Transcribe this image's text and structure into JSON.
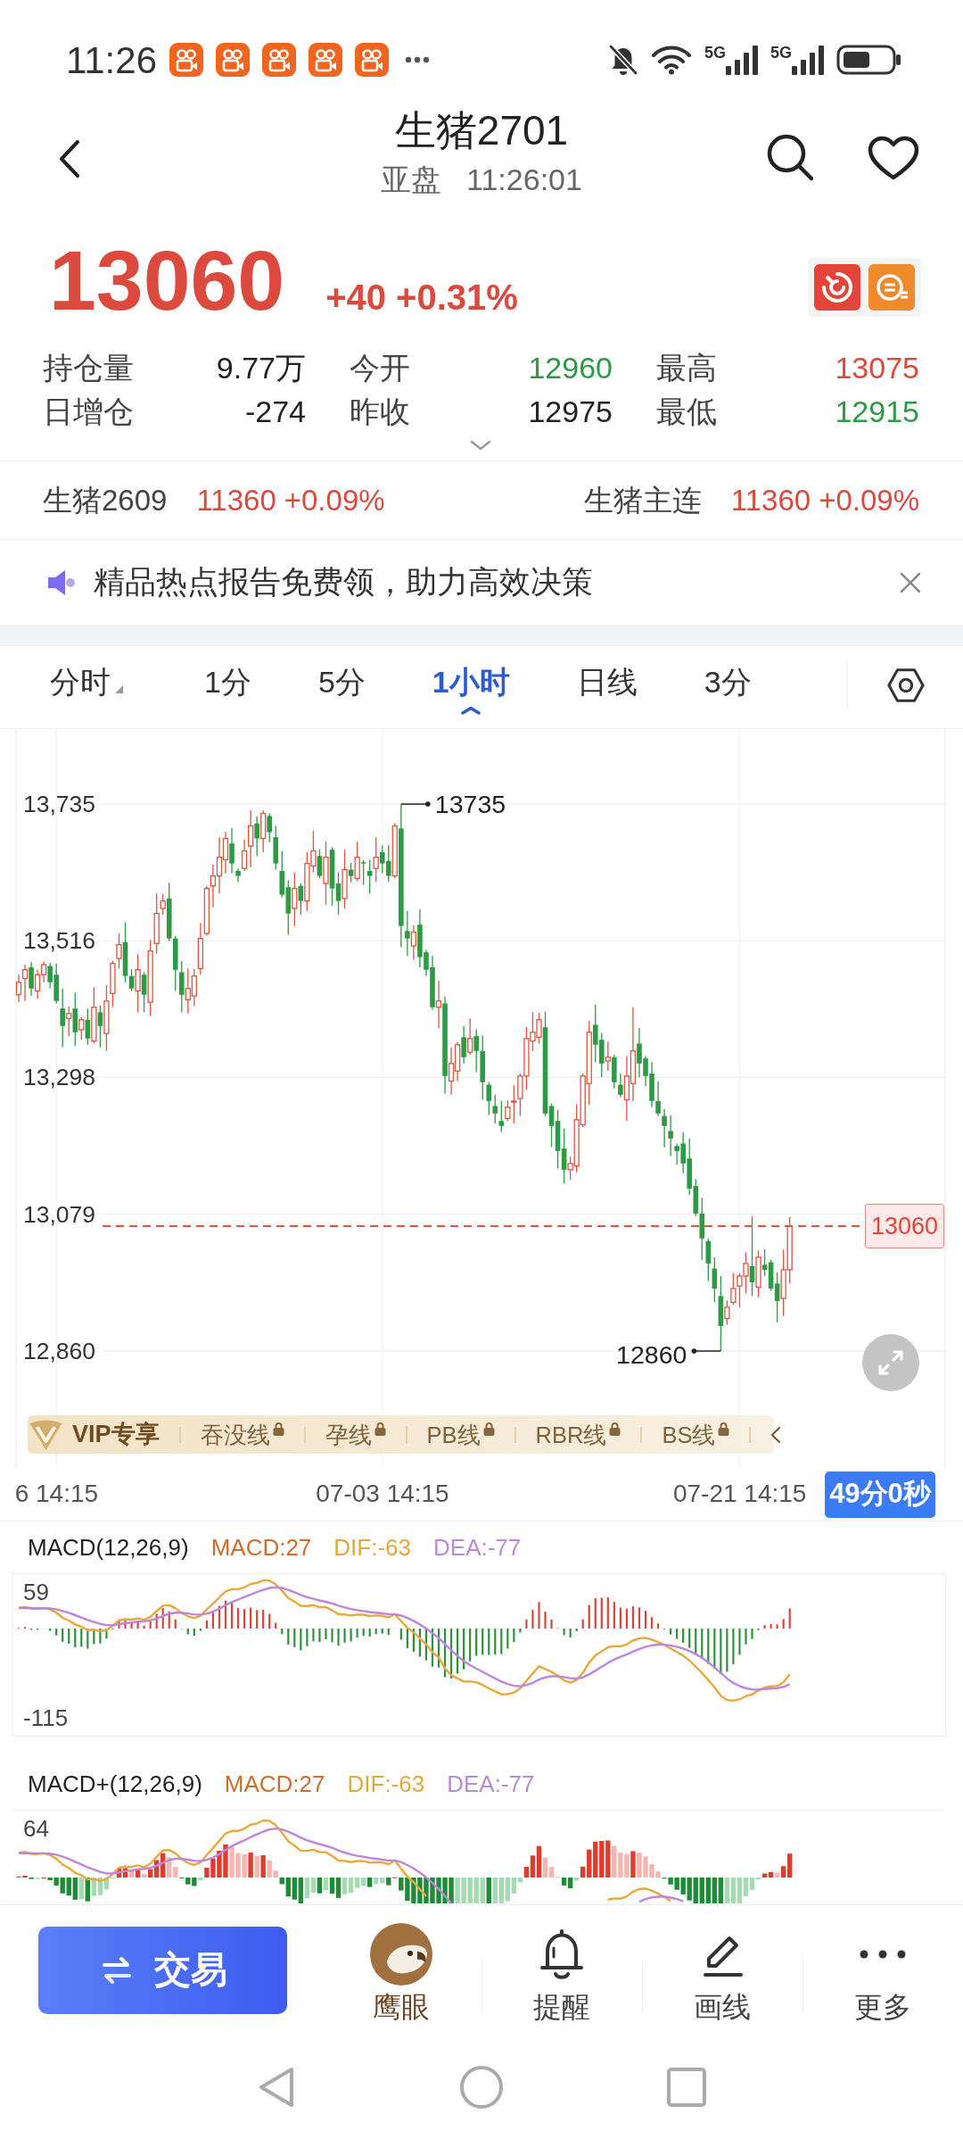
{
  "status_bar": {
    "time": "11:26",
    "network_labels": [
      "5G",
      "5G"
    ]
  },
  "header": {
    "title": "生猪2701",
    "session": "亚盘",
    "time": "11:26:01"
  },
  "quote": {
    "price": "13060",
    "change": "+40",
    "change_percent": "+0.31%",
    "rising": true
  },
  "stats": [
    {
      "label": "持仓量",
      "value": "9.77万",
      "color": "#222222"
    },
    {
      "label": "今开",
      "value": "12960",
      "color": "#2e9a48"
    },
    {
      "label": "最高",
      "value": "13075",
      "color": "#dc4a3e"
    },
    {
      "label": "日增仓",
      "value": "-274",
      "color": "#222222"
    },
    {
      "label": "昨收",
      "value": "12975",
      "color": "#222222"
    },
    {
      "label": "最低",
      "value": "12915",
      "color": "#2e9a48"
    }
  ],
  "related": [
    {
      "name": "生猪2609",
      "price": "11360",
      "change": "+0.09%",
      "color": "#dc4a3e"
    },
    {
      "name": "生猪主连",
      "price": "11360",
      "change": "+0.09%",
      "color": "#dc4a3e"
    }
  ],
  "banner": {
    "text": "精品热点报告免费领，助力高效决策"
  },
  "periods": [
    {
      "label": "分时",
      "selected": false,
      "dropdown": true
    },
    {
      "label": "1分",
      "selected": false,
      "dropdown": false
    },
    {
      "label": "5分",
      "selected": false,
      "dropdown": false
    },
    {
      "label": "1小时",
      "selected": true,
      "dropdown": false
    },
    {
      "label": "日线",
      "selected": false,
      "dropdown": false
    },
    {
      "label": "3分",
      "selected": false,
      "dropdown": false
    }
  ],
  "chart": {
    "chart_data": {
      "type": "candlestick",
      "categories": [
        null,
        null,
        null,
        null,
        null,
        null,
        "6 14:15",
        null,
        null,
        null,
        null,
        null,
        null,
        null,
        null,
        null,
        null,
        null,
        null,
        null,
        null,
        null,
        null,
        null,
        null,
        null,
        null,
        null,
        null,
        null,
        null,
        null,
        null,
        null,
        null,
        null,
        null,
        null,
        null,
        null,
        null,
        null,
        null,
        null,
        null,
        null,
        null,
        null,
        null,
        null,
        null,
        null,
        null,
        null,
        null,
        null,
        null,
        null,
        "07-03 14:15",
        null,
        null,
        null,
        null,
        null,
        null,
        null,
        null,
        null,
        null,
        null,
        null,
        null,
        null,
        null,
        null,
        null,
        null,
        null,
        null,
        null,
        null,
        null,
        null,
        null,
        null,
        null,
        null,
        null,
        null,
        null,
        null,
        null,
        null,
        null,
        null,
        null,
        null,
        null,
        null,
        null,
        null,
        null,
        null,
        null,
        null,
        null,
        null,
        null,
        null,
        null,
        null,
        null,
        null,
        null,
        null,
        "07-21 14:15",
        null,
        null,
        null,
        null,
        null,
        null,
        null,
        null
      ],
      "ohlc": [
        [
          13430,
          13462,
          13418,
          13450
        ],
        [
          13456,
          13478,
          13420,
          13470
        ],
        [
          13474,
          13482,
          13428,
          13440
        ],
        [
          13436,
          13470,
          13424,
          13462
        ],
        [
          13462,
          13483,
          13450,
          13478
        ],
        [
          13476,
          13481,
          13440,
          13450
        ],
        [
          13462,
          13480,
          13416,
          13420
        ],
        [
          13408,
          13440,
          13346,
          13380
        ],
        [
          13392,
          13411,
          13364,
          13400
        ],
        [
          13408,
          13433,
          13348,
          13370
        ],
        [
          13374,
          13394,
          13358,
          13390
        ],
        [
          13390,
          13408,
          13350,
          13360
        ],
        [
          13356,
          13442,
          13352,
          13410
        ],
        [
          13402,
          13413,
          13346,
          13380
        ],
        [
          13368,
          13445,
          13340,
          13420
        ],
        [
          13432,
          13484,
          13410,
          13480
        ],
        [
          13488,
          13528,
          13472,
          13510
        ],
        [
          13514,
          13546,
          13450,
          13460
        ],
        [
          13460,
          13471,
          13436,
          13440
        ],
        [
          13436,
          13495,
          13402,
          13470
        ],
        [
          13462,
          13466,
          13402,
          13430
        ],
        [
          13418,
          13518,
          13396,
          13500
        ],
        [
          13512,
          13592,
          13496,
          13560
        ],
        [
          13568,
          13591,
          13558,
          13580
        ],
        [
          13584,
          13609,
          13516,
          13520
        ],
        [
          13520,
          13524,
          13436,
          13470
        ],
        [
          13466,
          13484,
          13402,
          13430
        ],
        [
          13422,
          13472,
          13400,
          13440
        ],
        [
          13428,
          13471,
          13412,
          13460
        ],
        [
          13472,
          13545,
          13462,
          13520
        ],
        [
          13528,
          13604,
          13524,
          13600
        ],
        [
          13604,
          13638,
          13570,
          13620
        ],
        [
          13620,
          13682,
          13592,
          13650
        ],
        [
          13646,
          13691,
          13624,
          13680
        ],
        [
          13672,
          13697,
          13624,
          13640
        ],
        [
          13628,
          13632,
          13610,
          13620
        ],
        [
          13632,
          13678,
          13628,
          13660
        ],
        [
          13668,
          13725,
          13634,
          13700
        ],
        [
          13704,
          13715,
          13652,
          13680
        ],
        [
          13680,
          13725,
          13658,
          13720
        ],
        [
          13716,
          13720,
          13674,
          13690
        ],
        [
          13682,
          13700,
          13630,
          13640
        ],
        [
          13628,
          13660,
          13586,
          13590
        ],
        [
          13602,
          13613,
          13526,
          13560
        ],
        [
          13568,
          13625,
          13540,
          13600
        ],
        [
          13604,
          13608,
          13558,
          13580
        ],
        [
          13580,
          13658,
          13564,
          13640
        ],
        [
          13636,
          13692,
          13626,
          13660
        ],
        [
          13652,
          13663,
          13616,
          13620
        ],
        [
          13608,
          13675,
          13574,
          13650
        ],
        [
          13662,
          13666,
          13572,
          13600
        ],
        [
          13608,
          13626,
          13558,
          13580
        ],
        [
          13584,
          13662,
          13568,
          13630
        ],
        [
          13630,
          13641,
          13610,
          13620
        ],
        [
          13616,
          13675,
          13612,
          13650
        ],
        [
          13642,
          13646,
          13606,
          13640
        ],
        [
          13628,
          13646,
          13592,
          13620
        ],
        [
          13632,
          13682,
          13610,
          13650
        ],
        [
          13658,
          13669,
          13624,
          13640
        ],
        [
          13644,
          13669,
          13610,
          13620
        ],
        [
          13620,
          13704,
          13616,
          13700
        ],
        [
          13696,
          13735,
          13506,
          13540
        ],
        [
          13532,
          13564,
          13492,
          13520
        ],
        [
          13508,
          13541,
          13486,
          13530
        ],
        [
          13542,
          13567,
          13474,
          13490
        ],
        [
          13498,
          13502,
          13460,
          13470
        ],
        [
          13474,
          13492,
          13406,
          13410
        ],
        [
          13410,
          13452,
          13376,
          13420
        ],
        [
          13416,
          13427,
          13272,
          13300
        ],
        [
          13292,
          13345,
          13270,
          13320
        ],
        [
          13308,
          13354,
          13292,
          13350
        ],
        [
          13362,
          13380,
          13320,
          13330
        ],
        [
          13338,
          13392,
          13334,
          13360
        ],
        [
          13364,
          13375,
          13306,
          13340
        ],
        [
          13340,
          13365,
          13262,
          13290
        ],
        [
          13286,
          13290,
          13238,
          13260
        ],
        [
          13252,
          13270,
          13224,
          13240
        ],
        [
          13228,
          13260,
          13210,
          13220
        ],
        [
          13232,
          13261,
          13228,
          13250
        ],
        [
          13258,
          13285,
          13224,
          13260
        ],
        [
          13264,
          13304,
          13236,
          13300
        ],
        [
          13300,
          13378,
          13278,
          13360
        ],
        [
          13356,
          13402,
          13340,
          13370
        ],
        [
          13362,
          13401,
          13352,
          13390
        ],
        [
          13378,
          13403,
          13236,
          13240
        ],
        [
          13252,
          13256,
          13186,
          13220
        ],
        [
          13228,
          13246,
          13152,
          13180
        ],
        [
          13184,
          13216,
          13128,
          13150
        ],
        [
          13150,
          13171,
          13134,
          13160
        ],
        [
          13156,
          13255,
          13146,
          13230
        ],
        [
          13222,
          13304,
          13218,
          13300
        ],
        [
          13288,
          13388,
          13254,
          13370
        ],
        [
          13382,
          13414,
          13322,
          13350
        ],
        [
          13358,
          13369,
          13298,
          13320
        ],
        [
          13324,
          13355,
          13308,
          13330
        ],
        [
          13330,
          13334,
          13280,
          13290
        ],
        [
          13286,
          13304,
          13266,
          13270
        ],
        [
          13262,
          13332,
          13228,
          13300
        ],
        [
          13288,
          13410,
          13260,
          13340
        ],
        [
          13352,
          13377,
          13298,
          13320
        ],
        [
          13328,
          13332,
          13284,
          13300
        ],
        [
          13304,
          13322,
          13250,
          13260
        ],
        [
          13260,
          13292,
          13236,
          13240
        ],
        [
          13236,
          13247,
          13186,
          13220
        ],
        [
          13212,
          13237,
          13172,
          13200
        ],
        [
          13188,
          13192,
          13158,
          13180
        ],
        [
          13192,
          13210,
          13144,
          13160
        ],
        [
          13168,
          13200,
          13110,
          13120
        ],
        [
          13124,
          13135,
          13076,
          13080
        ],
        [
          13080,
          13105,
          13006,
          13040
        ],
        [
          13036,
          13040,
          12972,
          13000
        ],
        [
          12992,
          13010,
          12938,
          12960
        ],
        [
          12948,
          12980,
          12860,
          12900
        ],
        [
          12912,
          12941,
          12902,
          12930
        ],
        [
          12938,
          12985,
          12934,
          12960
        ],
        [
          12964,
          12984,
          12930,
          12980
        ],
        [
          12980,
          13018,
          12952,
          13000
        ],
        [
          12996,
          13075,
          12948,
          12970
        ],
        [
          12962,
          13021,
          12946,
          13010
        ],
        [
          12998,
          13023,
          12980,
          12990
        ],
        [
          13002,
          13006,
          12956,
          12960
        ],
        [
          12968,
          12986,
          12906,
          12940
        ],
        [
          12944,
          13022,
          12916,
          12990
        ],
        [
          12990,
          13075,
          12968,
          13060
        ]
      ],
      "yticks": [
        {
          "value": 13735,
          "label": "13,735"
        },
        {
          "value": 13516,
          "label": "13,516"
        },
        {
          "value": 13298,
          "label": "13,298"
        },
        {
          "value": 13079,
          "label": "13,079"
        },
        {
          "value": 12860,
          "label": "12,860"
        }
      ],
      "ylim": [
        12673,
        13855
      ],
      "grid": true,
      "ref_lines": [
        {
          "axis": "y",
          "value": 13060,
          "label": "13060"
        }
      ]
    },
    "high_label": "13735",
    "low_label": "12860",
    "countdown": "49分0秒"
  },
  "vip_bar": {
    "title": "VIP专享",
    "items": [
      {
        "label": "吞没线",
        "locked": true
      },
      {
        "label": "孕线",
        "locked": true
      },
      {
        "label": "PB线",
        "locked": true
      },
      {
        "label": "RBR线",
        "locked": true
      },
      {
        "label": "BS线",
        "locked": true
      }
    ]
  },
  "indicators": [
    {
      "name": "MACD(12,26,9)",
      "macd": "MACD:27",
      "dif": "DIF:-63",
      "dea": "DEA:-77",
      "top_label": "59",
      "bottom_label": "-115",
      "kind": "thin"
    },
    {
      "name": "MACD+(12,26,9)",
      "macd": "MACD:27",
      "dif": "DIF:-63",
      "dea": "DEA:-77",
      "top_label": "64",
      "kind": "shaded"
    }
  ],
  "toolbar": {
    "trade_button": "交易",
    "items": [
      {
        "label": "鹰眼",
        "kind": "eagle"
      },
      {
        "label": "提醒",
        "kind": "alert"
      },
      {
        "label": "画线",
        "kind": "draw"
      },
      {
        "label": "更多",
        "kind": "more"
      }
    ]
  }
}
